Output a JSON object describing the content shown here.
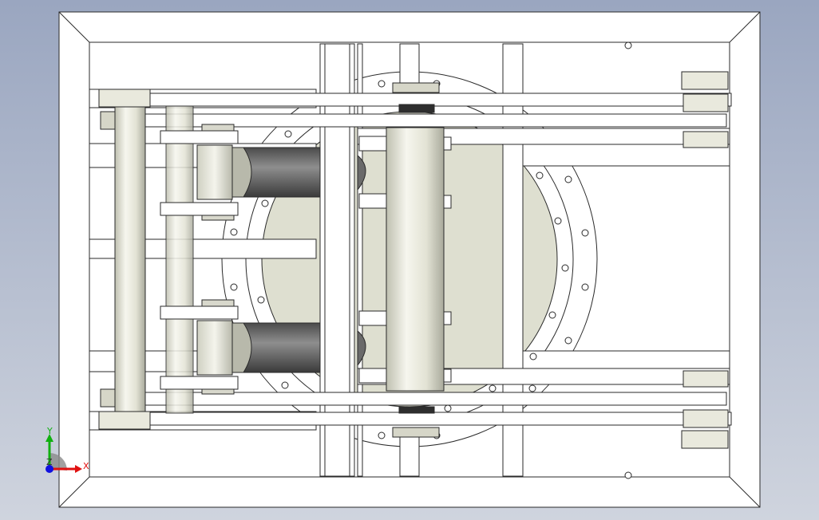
{
  "viewport": {
    "background_top": "#9aa6c0",
    "background_bottom": "#cfd4de"
  },
  "triad": {
    "x_label": "X",
    "y_label": "Y",
    "z_label": "Z",
    "x_color": "#e01010",
    "y_color": "#10b010",
    "z_color": "#1010e0"
  },
  "model": {
    "shaded_dark": "#6e6e6e",
    "shaded_light": "#e4e4d8",
    "plate_fill": "#dedfd0"
  }
}
